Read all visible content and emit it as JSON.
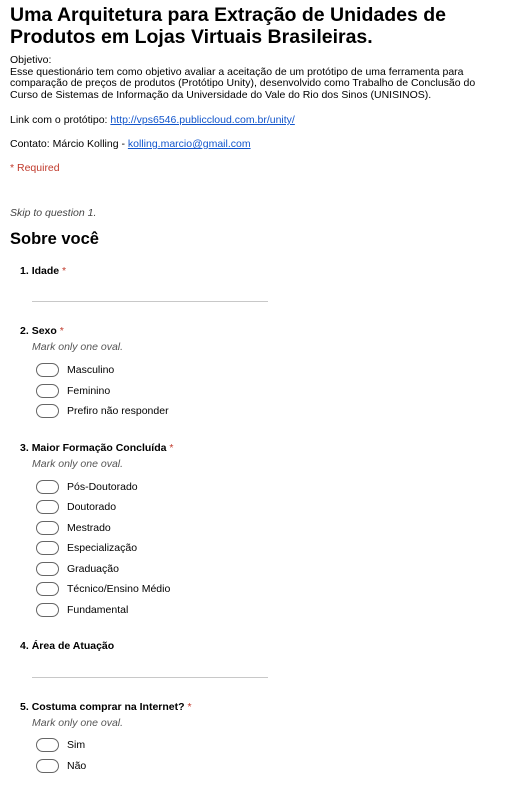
{
  "form": {
    "title": "Uma Arquitetura para Extração de Unidades de Produtos em Lojas Virtuais Brasileiras.",
    "description": {
      "objective_label": "Objetivo:",
      "lines": [
        "Esse questionário tem como objetivo avaliar a aceitação de um protótipo de uma ferramenta para",
        "comparação de preços de produtos (Protótipo Unity), desenvolvido como Trabalho de Conclusão do",
        "Curso de Sistemas de Informação da Universidade do Vale do Rio dos Sinos (UNISINOS)."
      ],
      "link_prefix": "Link com o protótipo: ",
      "link_text": "http://vps6546.publiccloud.com.br/unity/",
      "contact_prefix": "Contato: Márcio Kolling - ",
      "contact_email": "kolling.marcio@gmail.com"
    },
    "required_note": "* Required",
    "skip_text": "Skip to question 1.",
    "section_title": "Sobre você",
    "questions": [
      {
        "number": "1.",
        "title": "Idade",
        "star": "*"
      },
      {
        "number": "2.",
        "title": "Sexo",
        "star": "*",
        "hint": "Mark only one oval.",
        "options": [
          "Masculino",
          "Feminino",
          "Prefiro não responder"
        ]
      },
      {
        "number": "3.",
        "title": "Maior Formação Concluída",
        "star": "*",
        "hint": "Mark only one oval.",
        "options": [
          "Pós-Doutorado",
          "Doutorado",
          "Mestrado",
          "Especialização",
          "Graduação",
          "Técnico/Ensino Médio",
          "Fundamental"
        ]
      },
      {
        "number": "4.",
        "title": "Área de Atuação"
      },
      {
        "number": "5.",
        "title": "Costuma comprar na Internet?",
        "star": "*",
        "hint": "Mark only one oval.",
        "options": [
          "Sim",
          "Não"
        ]
      }
    ]
  }
}
